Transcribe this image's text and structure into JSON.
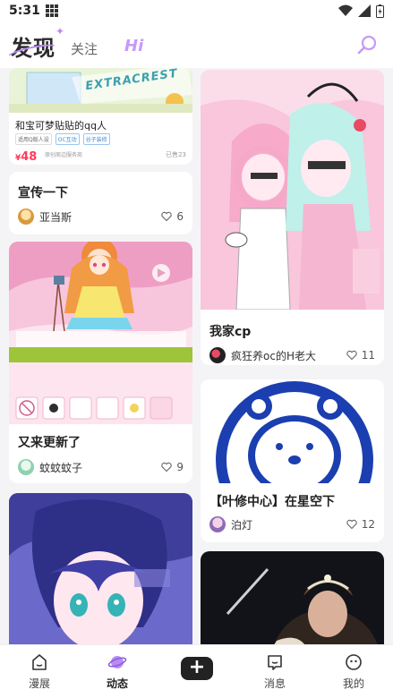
{
  "status_bar": {
    "time": "5:31"
  },
  "header": {
    "tabs": [
      {
        "label": "发现"
      },
      {
        "label": "关注"
      },
      {
        "label": "Hi"
      }
    ]
  },
  "feed": {
    "left": [
      {
        "ad": {
          "title": "和宝可梦贴贴的qq人",
          "tags": [
            "适用Q版人设",
            "OC互动",
            "谷子装修"
          ],
          "price": "48",
          "currency": "¥",
          "shop": "原创周边服务商",
          "sales": "已售23",
          "banner_text": "EXTRACREST"
        }
      },
      {
        "title": "宣传一下",
        "author": "亚当斯",
        "likes": "6"
      },
      {
        "title": "又来更新了",
        "author": "蚊蚊蚊子",
        "likes": "9"
      },
      {
        "title": "",
        "author": "",
        "likes": ""
      }
    ],
    "right": [
      {
        "title": "我家cp",
        "author": "疯狂养oc的H老大",
        "likes": "11"
      },
      {
        "title": "【叶修中心】在星空下",
        "author": "泊灯",
        "likes": "12"
      },
      {
        "title": "",
        "author": "",
        "likes": ""
      }
    ]
  },
  "bottom_nav": {
    "items": [
      {
        "label": "漫展"
      },
      {
        "label": "动态"
      },
      {
        "label": "+"
      },
      {
        "label": "消息"
      },
      {
        "label": "我的"
      }
    ]
  },
  "colors": {
    "accent": "#b98cf2",
    "price": "#ff3b5c"
  }
}
